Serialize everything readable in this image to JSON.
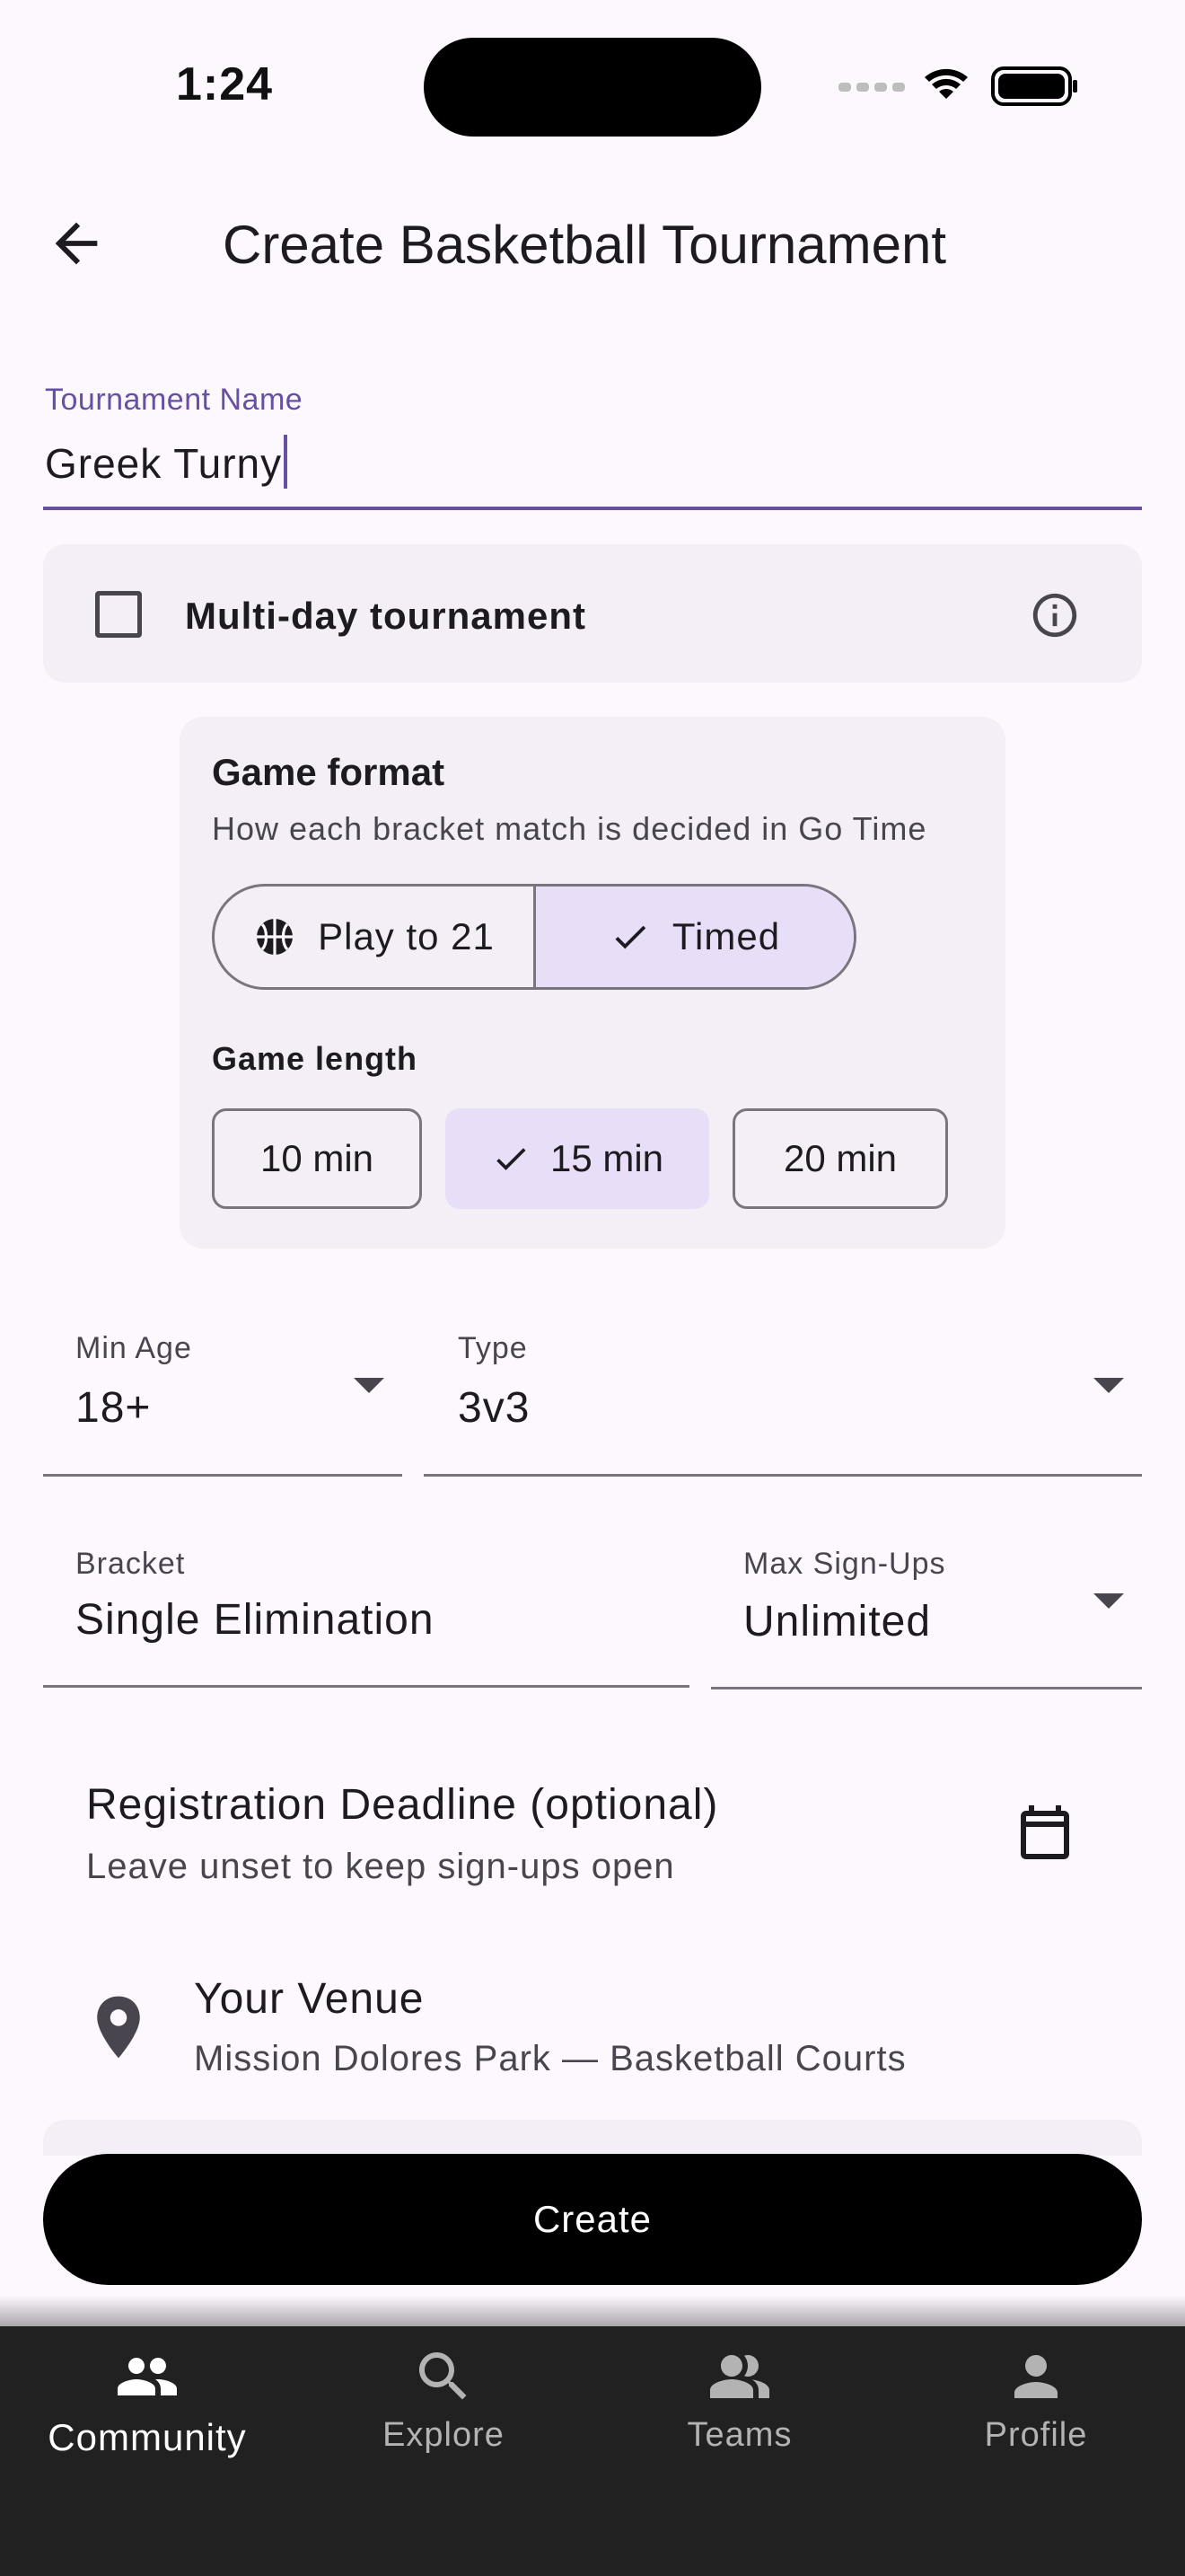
{
  "status_bar": {
    "time": "1:24"
  },
  "app_bar": {
    "title": "Create Basketball Tournament"
  },
  "tournament_name": {
    "label": "Tournament Name",
    "value": "Greek Turny"
  },
  "multi_day": {
    "label": "Multi-day tournament",
    "checked": false
  },
  "game_format": {
    "title": "Game format",
    "subtitle": "How each bracket match is decided in Go Time",
    "options": [
      {
        "label": "Play to 21",
        "icon": "basketball-icon",
        "selected": false
      },
      {
        "label": "Timed",
        "icon": "check-icon",
        "selected": true
      }
    ],
    "length_title": "Game length",
    "lengths": [
      {
        "label": "10 min",
        "selected": false
      },
      {
        "label": "15 min",
        "selected": true
      },
      {
        "label": "20 min",
        "selected": false
      }
    ]
  },
  "min_age": {
    "label": "Min Age",
    "value": "18+"
  },
  "type": {
    "label": "Type",
    "value": "3v3"
  },
  "bracket": {
    "label": "Bracket",
    "value": "Single Elimination"
  },
  "max_signups": {
    "label": "Max Sign-Ups",
    "value": "Unlimited"
  },
  "registration": {
    "title": "Registration Deadline (optional)",
    "subtitle": "Leave unset to keep sign-ups open",
    "icon": "calendar-icon"
  },
  "venue": {
    "title": "Your Venue",
    "subtitle": "Mission Dolores Park — Basketball Courts",
    "icon": "location-pin-icon"
  },
  "create_button": {
    "label": "Create"
  },
  "bottom_nav": {
    "items": [
      {
        "label": "Community",
        "icon": "community-icon",
        "active": true
      },
      {
        "label": "Explore",
        "icon": "search-icon",
        "active": false
      },
      {
        "label": "Teams",
        "icon": "teams-icon",
        "active": false
      },
      {
        "label": "Profile",
        "icon": "profile-icon",
        "active": false
      }
    ]
  },
  "colors": {
    "background": "#fdf7fe",
    "accent": "#6750a4",
    "selected_fill": "#e8def8",
    "card": "#f4eff6",
    "nav_background": "#212121"
  }
}
